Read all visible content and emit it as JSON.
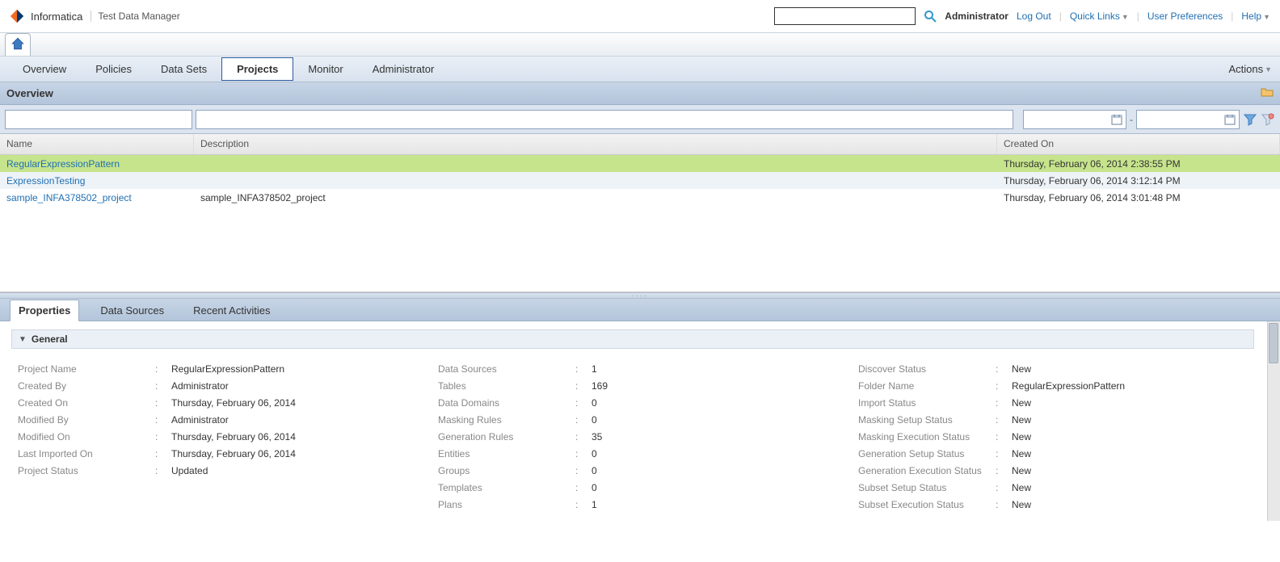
{
  "brand": "Informatica",
  "product": "Test Data Manager",
  "user": "Administrator",
  "header_links": {
    "logout": "Log Out",
    "quick_links": "Quick Links",
    "user_prefs": "User Preferences",
    "help": "Help"
  },
  "menu": {
    "overview": "Overview",
    "policies": "Policies",
    "data_sets": "Data Sets",
    "projects": "Projects",
    "monitor": "Monitor",
    "administrator": "Administrator",
    "actions": "Actions"
  },
  "overview_title": "Overview",
  "grid_headers": {
    "name": "Name",
    "description": "Description",
    "created_on": "Created On"
  },
  "rows": [
    {
      "name": "RegularExpressionPattern",
      "description": "",
      "created_on": "Thursday, February 06, 2014 2:38:55 PM"
    },
    {
      "name": "ExpressionTesting",
      "description": "",
      "created_on": "Thursday, February 06, 2014 3:12:14 PM"
    },
    {
      "name": "sample_INFA378502_project",
      "description": "sample_INFA378502_project",
      "created_on": "Thursday, February 06, 2014 3:01:48 PM"
    }
  ],
  "lower_tabs": {
    "properties": "Properties",
    "data_sources": "Data Sources",
    "recent": "Recent Activities"
  },
  "section_general": "General",
  "details": {
    "col1": [
      {
        "label": "Project Name",
        "value": "RegularExpressionPattern"
      },
      {
        "label": "Created By",
        "value": "Administrator"
      },
      {
        "label": "Created On",
        "value": "Thursday, February 06, 2014"
      },
      {
        "label": "Modified By",
        "value": "Administrator"
      },
      {
        "label": "Modified On",
        "value": "Thursday, February 06, 2014"
      },
      {
        "label": "Last Imported On",
        "value": "Thursday, February 06, 2014"
      },
      {
        "label": "Project Status",
        "value": "Updated"
      }
    ],
    "col2": [
      {
        "label": "Data Sources",
        "value": "1"
      },
      {
        "label": "Tables",
        "value": "169"
      },
      {
        "label": "Data Domains",
        "value": "0"
      },
      {
        "label": "Masking Rules",
        "value": "0"
      },
      {
        "label": "Generation Rules",
        "value": "35"
      },
      {
        "label": "Entities",
        "value": "0"
      },
      {
        "label": "Groups",
        "value": "0"
      },
      {
        "label": "Templates",
        "value": "0"
      },
      {
        "label": "Plans",
        "value": "1"
      }
    ],
    "col3": [
      {
        "label": "Discover Status",
        "value": "New"
      },
      {
        "label": "Folder Name",
        "value": "RegularExpressionPattern"
      },
      {
        "label": "Import Status",
        "value": "New"
      },
      {
        "label": "Masking Setup Status",
        "value": "New"
      },
      {
        "label": "Masking Execution Status",
        "value": "New"
      },
      {
        "label": "Generation Setup Status",
        "value": "New"
      },
      {
        "label": "Generation Execution Status",
        "value": "New"
      },
      {
        "label": "Subset Setup Status",
        "value": "New"
      },
      {
        "label": "Subset Execution Status",
        "value": "New"
      }
    ]
  }
}
